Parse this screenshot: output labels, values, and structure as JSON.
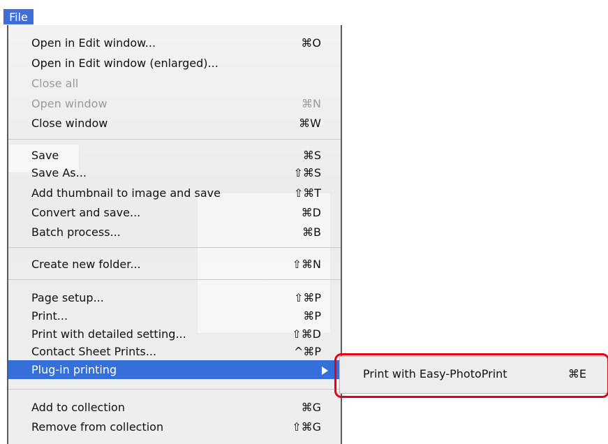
{
  "menu_bar": {
    "title": "File"
  },
  "menu": {
    "items": [
      {
        "label": "Open in Edit window...",
        "shortcut": "⌘O",
        "enabled": true
      },
      {
        "label": "Open in Edit window (enlarged)...",
        "shortcut": "",
        "enabled": true
      },
      {
        "label": "Close all",
        "shortcut": "",
        "enabled": false
      },
      {
        "label": "Open window",
        "shortcut": "⌘N",
        "enabled": false
      },
      {
        "label": "Close window",
        "shortcut": "⌘W",
        "enabled": true
      },
      {
        "label": "Save",
        "shortcut": "⌘S",
        "enabled": true
      },
      {
        "label": "Save As...",
        "shortcut": "⇧⌘S",
        "enabled": true
      },
      {
        "label": "Add thumbnail to image and save",
        "shortcut": "⇧⌘T",
        "enabled": true
      },
      {
        "label": "Convert and save...",
        "shortcut": "⌘D",
        "enabled": true
      },
      {
        "label": "Batch process...",
        "shortcut": "⌘B",
        "enabled": true
      },
      {
        "label": "Create new folder...",
        "shortcut": "⇧⌘N",
        "enabled": true
      },
      {
        "label": "Page setup...",
        "shortcut": "⇧⌘P",
        "enabled": true
      },
      {
        "label": "Print...",
        "shortcut": "⌘P",
        "enabled": true
      },
      {
        "label": "Print with detailed setting...",
        "shortcut": "⇧⌘D",
        "enabled": true
      },
      {
        "label": "Contact Sheet Prints...",
        "shortcut": "^⌘P",
        "enabled": true
      },
      {
        "label": "Plug-in printing",
        "shortcut": "",
        "enabled": true,
        "selected": true,
        "has_submenu": true
      },
      {
        "label": "Add to collection",
        "shortcut": "⌘G",
        "enabled": true
      },
      {
        "label": "Remove from collection",
        "shortcut": "⇧⌘G",
        "enabled": true
      }
    ]
  },
  "submenu": {
    "items": [
      {
        "label": "Print with Easy-PhotoPrint",
        "shortcut": "⌘E"
      }
    ]
  },
  "colors": {
    "selection": "#3570d8",
    "title_bg": "#3f6fd6",
    "callout": "#e60012",
    "disabled_text": "#9a9a9a"
  }
}
